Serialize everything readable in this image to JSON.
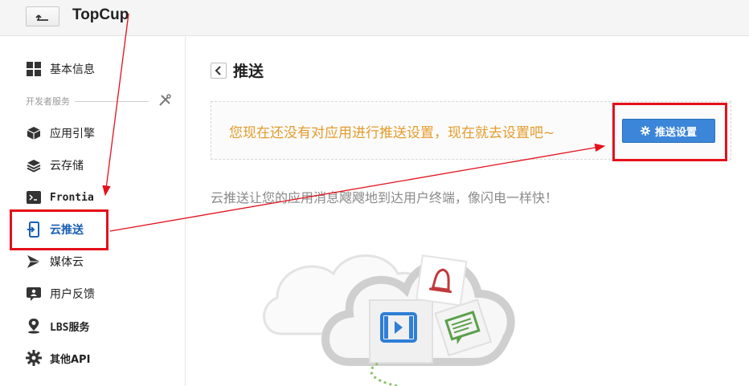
{
  "header": {
    "app_title": "TopCup"
  },
  "sidebar": {
    "section_label": "开发者服务",
    "items": [
      {
        "label": "基本信息",
        "icon": "grid-icon"
      },
      {
        "label": "应用引擎",
        "icon": "cube-icon"
      },
      {
        "label": "云存储",
        "icon": "layers-icon"
      },
      {
        "label": "Frontia",
        "icon": "terminal-icon"
      },
      {
        "label": "云推送",
        "icon": "push-phone-icon",
        "active": true
      },
      {
        "label": "媒体云",
        "icon": "play-arrow-icon"
      },
      {
        "label": "用户反馈",
        "icon": "feedback-icon"
      },
      {
        "label": "LBS服务",
        "icon": "location-pin-icon"
      },
      {
        "label": "其他API",
        "icon": "gear-icon"
      }
    ]
  },
  "main": {
    "title": "推送",
    "notice_text": "您现在还没有对应用进行推送设置，现在就去设置吧~",
    "push_button_label": "推送设置",
    "description": "云推送让您的应用消息飕飕地到达用户终端，像闪电一样快！"
  },
  "colors": {
    "accent": "#3b86d9",
    "notice": "#e49b2b",
    "annotation_red": "#e4101b",
    "active_text": "#1a5fb4"
  }
}
